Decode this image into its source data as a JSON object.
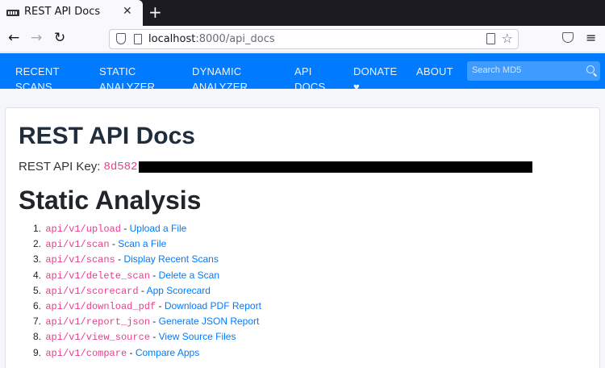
{
  "browser": {
    "tab_title": "REST API Docs",
    "tab_close": "✕",
    "new_tab": "+",
    "url_host": "localhost",
    "url_rest": ":8000/api_docs",
    "back": "←",
    "forward": "→",
    "reload": "↻",
    "star": "☆",
    "menu": "≡"
  },
  "site_nav": {
    "links": [
      {
        "line1": "RECENT",
        "line2": "SCANS"
      },
      {
        "line1": "STATIC",
        "line2": "ANALYZER"
      },
      {
        "line1": "DYNAMIC",
        "line2": "ANALYZER"
      },
      {
        "line1": "API",
        "line2": "DOCS"
      },
      {
        "line1": "DONATE",
        "line2": "♥"
      },
      {
        "line1": "ABOUT",
        "line2": ""
      }
    ],
    "search_placeholder": "Search MD5"
  },
  "main": {
    "title": "REST API Docs",
    "api_key_label": "REST API Key:",
    "api_key_value": "8d582",
    "section_title": "Static Analysis",
    "endpoints": [
      {
        "num": "1.",
        "path": "api/v1/upload",
        "sep": " - ",
        "label": "Upload a File"
      },
      {
        "num": "2.",
        "path": "api/v1/scan",
        "sep": " - ",
        "label": "Scan a File"
      },
      {
        "num": "3.",
        "path": "api/v1/scans",
        "sep": " - ",
        "label": "Display Recent Scans"
      },
      {
        "num": "4.",
        "path": "api/v1/delete_scan",
        "sep": " - ",
        "label": "Delete a Scan"
      },
      {
        "num": "5.",
        "path": "api/v1/scorecard",
        "sep": " - ",
        "label": "App Scorecard"
      },
      {
        "num": "6.",
        "path": "api/v1/download_pdf",
        "sep": " - ",
        "label": "Download PDF Report"
      },
      {
        "num": "7.",
        "path": "api/v1/report_json",
        "sep": " - ",
        "label": "Generate JSON Report"
      },
      {
        "num": "8.",
        "path": "api/v1/view_source",
        "sep": " - ",
        "label": "View Source Files"
      },
      {
        "num": "9.",
        "path": "api/v1/compare",
        "sep": " - ",
        "label": "Compare Apps"
      }
    ]
  },
  "colors": {
    "nav_bg": "#007bff",
    "code": "#e83e8c",
    "link": "#007bff"
  }
}
